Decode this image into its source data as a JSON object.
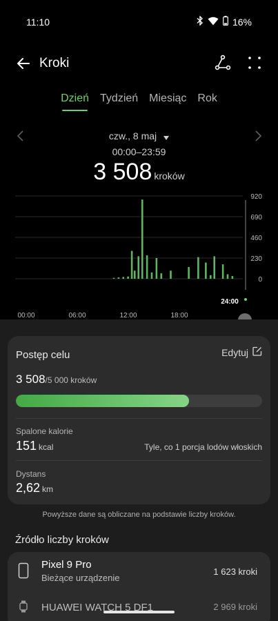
{
  "status": {
    "time": "11:10",
    "battery": "16%"
  },
  "appbar": {
    "title": "Kroki"
  },
  "tabs": [
    "Dzień",
    "Tydzień",
    "Miesiąc",
    "Rok"
  ],
  "date": {
    "label": "czw., 8 maj",
    "range": "00:00–23:59",
    "total": "3 508",
    "unit": "kroków"
  },
  "chart_data": {
    "type": "bar",
    "x_ticks": [
      "00:00",
      "06:00",
      "12:00",
      "18:00",
      "24:00"
    ],
    "y_ticks": [
      "920",
      "690",
      "460",
      "230",
      "0"
    ],
    "ylim": [
      0,
      920
    ],
    "series": [
      {
        "values": [
          {
            "hour": 10.4,
            "steps": 10
          },
          {
            "hour": 10.9,
            "steps": 15
          },
          {
            "hour": 11.4,
            "steps": 20
          },
          {
            "hour": 11.9,
            "steps": 25
          },
          {
            "hour": 12.3,
            "steps": 310
          },
          {
            "hour": 12.6,
            "steps": 90
          },
          {
            "hour": 13.0,
            "steps": 250
          },
          {
            "hour": 13.4,
            "steps": 880
          },
          {
            "hour": 13.9,
            "steps": 260
          },
          {
            "hour": 14.4,
            "steps": 70
          },
          {
            "hour": 14.9,
            "steps": 230
          },
          {
            "hour": 15.4,
            "steps": 60
          },
          {
            "hour": 16.4,
            "steps": 90
          },
          {
            "hour": 18.3,
            "steps": 130
          },
          {
            "hour": 19.3,
            "steps": 240
          },
          {
            "hour": 20.1,
            "steps": 180
          },
          {
            "hour": 20.6,
            "steps": 40
          },
          {
            "hour": 21.0,
            "steps": 250
          },
          {
            "hour": 21.9,
            "steps": 160
          },
          {
            "hour": 22.4,
            "steps": 50
          },
          {
            "hour": 22.9,
            "steps": 30
          }
        ]
      }
    ],
    "grid": true,
    "current_marker": "24:00"
  },
  "goal": {
    "title": "Postęp celu",
    "edit_label": "Edytuj",
    "value": "3 508",
    "goal_text": "/5 000 kroków",
    "progress": 0.702
  },
  "calories": {
    "label": "Spalone kalorie",
    "value": "151",
    "unit": "kcal",
    "note": "Tyle, co 1 porcja lodów włoskich"
  },
  "distance": {
    "label": "Dystans",
    "value": "2,62",
    "unit": "km"
  },
  "footnote": "Powyższe dane są obliczane na podstawie liczby kroków.",
  "source": {
    "title": "Źródło liczby kroków",
    "devices": [
      {
        "name": "Pixel 9 Pro",
        "sub": "Bieżące urządzenie",
        "count": "1 623 kroki"
      },
      {
        "name": "HUAWEI WATCH 5 DF1",
        "count": "2 969 kroki"
      }
    ]
  },
  "colors": {
    "accent": "#6fcf6f",
    "background": "#000000",
    "card": "#2c2c2c"
  }
}
